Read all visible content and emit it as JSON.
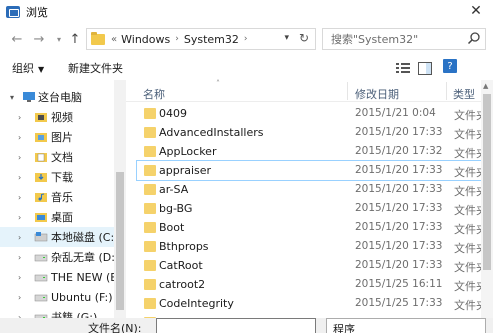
{
  "window": {
    "title": "浏览"
  },
  "address": {
    "crumb_prefix": "«",
    "crumbs": [
      "Windows",
      "System32"
    ],
    "search_placeholder": "搜索\"System32\""
  },
  "toolbar": {
    "organize_label": "组织",
    "new_folder_label": "新建文件夹"
  },
  "nav": {
    "items": [
      {
        "label": "这台电脑",
        "icon": "computer-icon"
      },
      {
        "label": "视频",
        "icon": "video-folder-icon"
      },
      {
        "label": "图片",
        "icon": "pictures-folder-icon"
      },
      {
        "label": "文档",
        "icon": "documents-folder-icon"
      },
      {
        "label": "下载",
        "icon": "downloads-folder-icon"
      },
      {
        "label": "音乐",
        "icon": "music-folder-icon"
      },
      {
        "label": "桌面",
        "icon": "desktop-folder-icon"
      },
      {
        "label": "本地磁盘 (C:)",
        "icon": "local-disk-icon"
      },
      {
        "label": "杂乱无章 (D:)",
        "icon": "drive-icon"
      },
      {
        "label": "THE NEW (E:",
        "icon": "drive-icon"
      },
      {
        "label": "Ubuntu (F:)",
        "icon": "drive-icon"
      },
      {
        "label": "书籍 (G:)",
        "icon": "drive-icon"
      }
    ]
  },
  "columns": {
    "name": "名称",
    "date": "修改日期",
    "type": "类型"
  },
  "files": [
    {
      "name": "0409",
      "date": "2015/1/21 0:04",
      "type": "文件夹"
    },
    {
      "name": "AdvancedInstallers",
      "date": "2015/1/20 17:33",
      "type": "文件夹"
    },
    {
      "name": "AppLocker",
      "date": "2015/1/20 17:32",
      "type": "文件夹"
    },
    {
      "name": "appraiser",
      "date": "2015/1/20 17:33",
      "type": "文件夹"
    },
    {
      "name": "ar-SA",
      "date": "2015/1/20 17:33",
      "type": "文件夹"
    },
    {
      "name": "bg-BG",
      "date": "2015/1/20 17:33",
      "type": "文件夹"
    },
    {
      "name": "Boot",
      "date": "2015/1/20 17:33",
      "type": "文件夹"
    },
    {
      "name": "Bthprops",
      "date": "2015/1/20 17:33",
      "type": "文件夹"
    },
    {
      "name": "CatRoot",
      "date": "2015/1/20 17:33",
      "type": "文件夹"
    },
    {
      "name": "catroot2",
      "date": "2015/1/25 16:11",
      "type": "文件夹"
    },
    {
      "name": "CodeIntegrity",
      "date": "2015/1/25 17:33",
      "type": "文件夹"
    }
  ],
  "footer": {
    "filename_label": "文件名(N):",
    "filter_label": "程序"
  },
  "colors": {
    "accent": "#2a73c5",
    "selection": "#e5f3fb",
    "folder": "#f5d26b",
    "header_text": "#4c607a"
  }
}
